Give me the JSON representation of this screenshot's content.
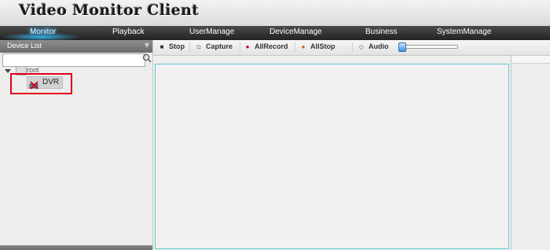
{
  "app": {
    "title": "Video Monitor Client"
  },
  "menu": {
    "items": [
      "Monitor",
      "Playback",
      "UserManage",
      "DeviceManage",
      "Business",
      "SystemManage"
    ],
    "active": "Monitor"
  },
  "device_list": {
    "header": "Device List",
    "search_value": "",
    "tree": {
      "root_label": "root",
      "children": [
        {
          "label": "DVR",
          "status": "offline"
        }
      ]
    }
  },
  "toolbar": {
    "stop": "Stop",
    "capture": "Capture",
    "allrecord": "AllRecord",
    "allstop": "AllStop",
    "audio": "Audio"
  },
  "colors": {
    "highlight": "#e2001a",
    "active_menu_glow": "#2fb3ff",
    "video_border": "#58cbd6"
  }
}
